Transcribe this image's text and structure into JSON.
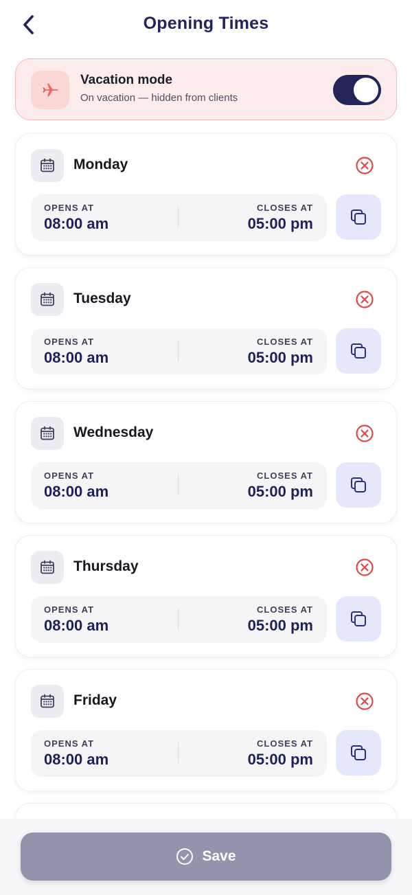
{
  "header": {
    "title": "Opening Times",
    "back_icon": "chevron-left-icon"
  },
  "vacation": {
    "title": "Vacation mode",
    "subtitle": "On vacation — hidden from clients",
    "enabled": true,
    "icon": "airplane-icon"
  },
  "days": [
    {
      "name": "Monday",
      "opens_label": "OPENS AT",
      "opens": "08:00 am",
      "closes_label": "CLOSES AT",
      "closes": "05:00 pm"
    },
    {
      "name": "Tuesday",
      "opens_label": "OPENS AT",
      "opens": "08:00 am",
      "closes_label": "CLOSES AT",
      "closes": "05:00 pm"
    },
    {
      "name": "Wednesday",
      "opens_label": "OPENS AT",
      "opens": "08:00 am",
      "closes_label": "CLOSES AT",
      "closes": "05:00 pm"
    },
    {
      "name": "Thursday",
      "opens_label": "OPENS AT",
      "opens": "08:00 am",
      "closes_label": "CLOSES AT",
      "closes": "05:00 pm"
    },
    {
      "name": "Friday",
      "opens_label": "OPENS AT",
      "opens": "08:00 am",
      "closes_label": "CLOSES AT",
      "closes": "05:00 pm"
    }
  ],
  "footer": {
    "save_label": "Save",
    "save_icon": "check-circle-icon"
  },
  "colors": {
    "primary": "#22245a",
    "vacation_bg": "#fdecec",
    "vacation_accent": "#f06464",
    "remove": "#e04848",
    "copy_bg": "#e5e7fb",
    "save_bg": "#9294ad"
  }
}
